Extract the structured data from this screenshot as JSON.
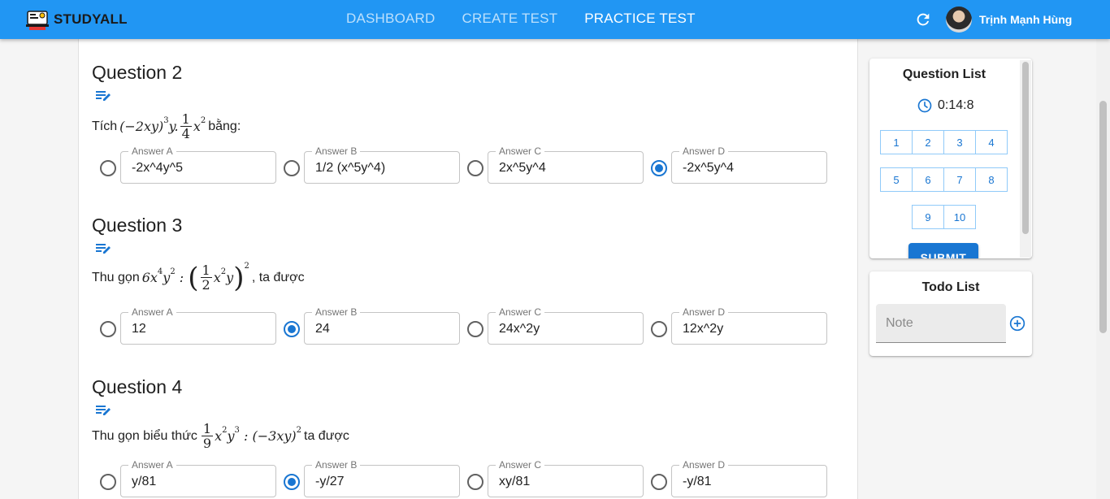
{
  "app": {
    "brand": "STUDYALL"
  },
  "nav": {
    "items": [
      {
        "label": "DASHBOARD",
        "active": false
      },
      {
        "label": "CREATE TEST",
        "active": false
      },
      {
        "label": "PRACTICE TEST",
        "active": true
      }
    ]
  },
  "user": {
    "name": "Trịnh Mạnh Hùng"
  },
  "questions": [
    {
      "title": "Question 2",
      "prefix": "Tích",
      "suffix": "bằng:",
      "answers": [
        {
          "label": "Answer A",
          "value": "-2x^4y^5",
          "selected": false
        },
        {
          "label": "Answer B",
          "value": "1/2 (x^5y^4)",
          "selected": false
        },
        {
          "label": "Answer C",
          "value": "2x^5y^4",
          "selected": false
        },
        {
          "label": "Answer D",
          "value": "-2x^5y^4",
          "selected": true
        }
      ]
    },
    {
      "title": "Question 3",
      "prefix": "Thu gọn",
      "suffix": ", ta được",
      "answers": [
        {
          "label": "Answer A",
          "value": "12",
          "selected": false
        },
        {
          "label": "Answer B",
          "value": "24",
          "selected": true
        },
        {
          "label": "Answer C",
          "value": "24x^2y",
          "selected": false
        },
        {
          "label": "Answer D",
          "value": "12x^2y",
          "selected": false
        }
      ]
    },
    {
      "title": "Question 4",
      "prefix": "Thu gọn biểu thức",
      "suffix": "ta được",
      "answers": [
        {
          "label": "Answer A",
          "value": "y/81",
          "selected": false
        },
        {
          "label": "Answer B",
          "value": "-y/27",
          "selected": true
        },
        {
          "label": "Answer C",
          "value": "xy/81",
          "selected": false
        },
        {
          "label": "Answer D",
          "value": "-y/81",
          "selected": false
        }
      ]
    }
  ],
  "question_list": {
    "title": "Question List",
    "timer": "0:14:8",
    "numbers": [
      "1",
      "2",
      "3",
      "4",
      "5",
      "6",
      "7",
      "8",
      "9",
      "10"
    ],
    "submit_label": "SUBMIT"
  },
  "todo": {
    "title": "Todo List",
    "placeholder": "Note"
  },
  "colors": {
    "primary": "#2196f3",
    "accent": "#1976d2"
  }
}
